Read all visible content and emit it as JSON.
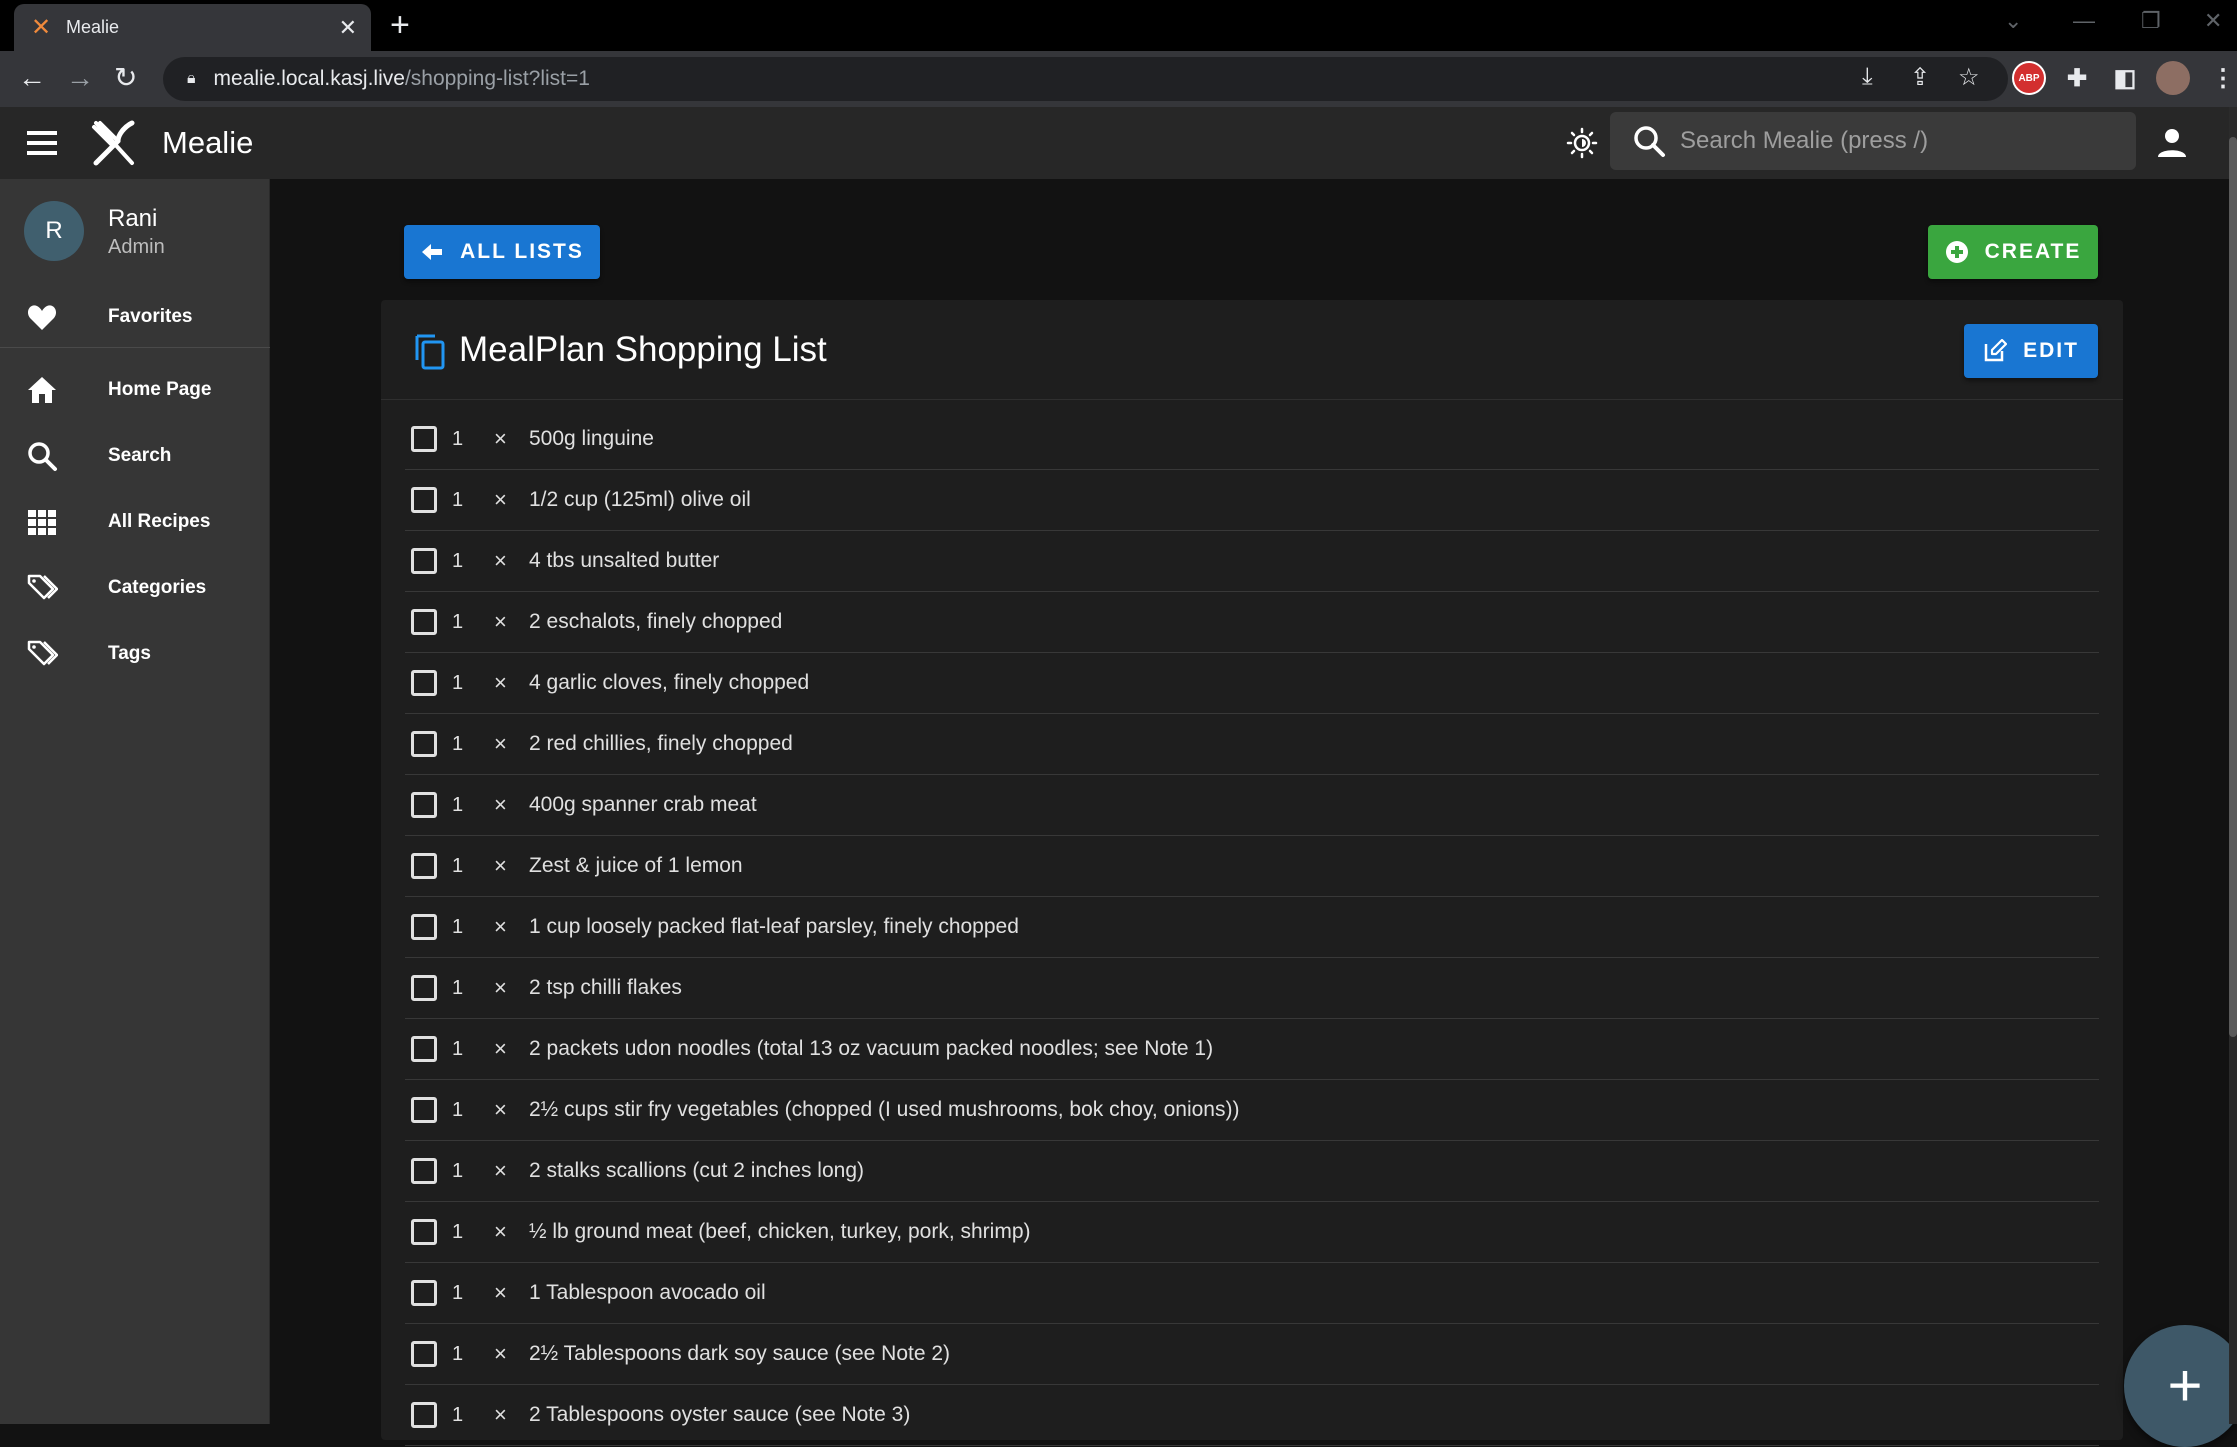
{
  "browser": {
    "tab_title": "Mealie",
    "url_host": "mealie.local.kasj.live",
    "url_path": "/shopping-list?list=1"
  },
  "appbar": {
    "app_name": "Mealie",
    "search_placeholder": "Search Mealie (press /)"
  },
  "sidebar": {
    "user": {
      "initial": "R",
      "name": "Rani",
      "role": "Admin"
    },
    "items": [
      {
        "label": "Favorites",
        "icon": "heart-icon"
      },
      {
        "label": "Home Page",
        "icon": "home-icon"
      },
      {
        "label": "Search",
        "icon": "search-icon"
      },
      {
        "label": "All Recipes",
        "icon": "grid-icon"
      },
      {
        "label": "Categories",
        "icon": "tags-icon"
      },
      {
        "label": "Tags",
        "icon": "tags-icon"
      }
    ]
  },
  "main": {
    "all_lists_label": "ALL LISTS",
    "create_label": "CREATE",
    "list_title": "MealPlan Shopping List",
    "edit_label": "EDIT",
    "times_symbol": "×",
    "items": [
      {
        "qty": "1",
        "text": "500g linguine"
      },
      {
        "qty": "1",
        "text": "1/2 cup (125ml) olive oil"
      },
      {
        "qty": "1",
        "text": "4 tbs unsalted butter"
      },
      {
        "qty": "1",
        "text": "2 eschalots, finely chopped"
      },
      {
        "qty": "1",
        "text": "4 garlic cloves, finely chopped"
      },
      {
        "qty": "1",
        "text": "2 red chillies, finely chopped"
      },
      {
        "qty": "1",
        "text": "400g spanner crab meat"
      },
      {
        "qty": "1",
        "text": "Zest & juice of 1 lemon"
      },
      {
        "qty": "1",
        "text": "1 cup loosely packed flat-leaf parsley, finely chopped"
      },
      {
        "qty": "1",
        "text": "2 tsp chilli flakes"
      },
      {
        "qty": "1",
        "text": "2 packets udon noodles (total 13 oz vacuum packed noodles; see Note 1)"
      },
      {
        "qty": "1",
        "text": "2½ cups stir fry vegetables (chopped (I used mushrooms, bok choy, onions))"
      },
      {
        "qty": "1",
        "text": "2 stalks scallions (cut 2 inches long)"
      },
      {
        "qty": "1",
        "text": "½ lb ground meat (beef, chicken, turkey, pork, shrimp)"
      },
      {
        "qty": "1",
        "text": "1 Tablespoon avocado oil"
      },
      {
        "qty": "1",
        "text": "2½ Tablespoons dark soy sauce (see Note 2)"
      },
      {
        "qty": "1",
        "text": "2 Tablespoons oyster sauce (see Note 3)"
      }
    ]
  },
  "colors": {
    "primary": "#1976d2",
    "success": "#3aa63f",
    "appbar": "#272727",
    "sidebar": "#363636",
    "card": "#1e1e1e"
  }
}
